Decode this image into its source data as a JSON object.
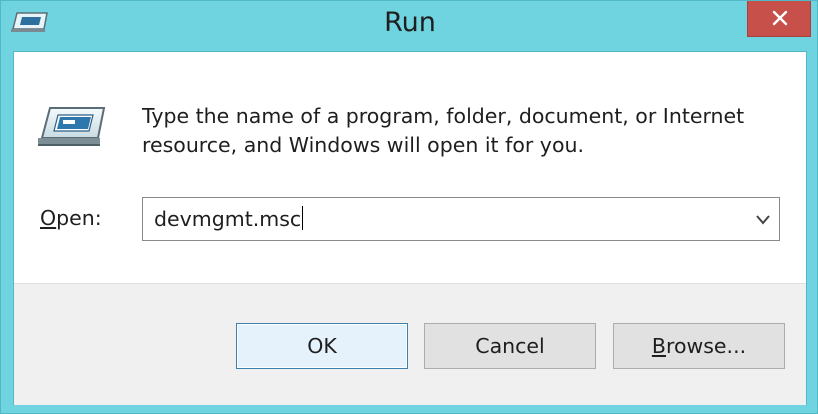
{
  "window": {
    "title": "Run",
    "close_icon": "close-icon",
    "app_icon": "run-app-icon"
  },
  "dialog": {
    "icon": "run-icon",
    "message_line1": "Type the name of a program, folder, document, or Internet",
    "message_line2": "resource, and Windows will open it for you.",
    "open_label_mnemonic": "O",
    "open_label_rest": "pen:",
    "open_value": "devmgmt.msc"
  },
  "buttons": {
    "ok_label": "OK",
    "cancel_label": "Cancel",
    "browse_mnemonic": "B",
    "browse_rest": "rowse..."
  },
  "colors": {
    "frame": "#6fd4df",
    "close_button": "#c7504b",
    "client_bg": "#ffffff",
    "footer_bg": "#f0f0f0",
    "default_button_border": "#3c7fb1"
  }
}
